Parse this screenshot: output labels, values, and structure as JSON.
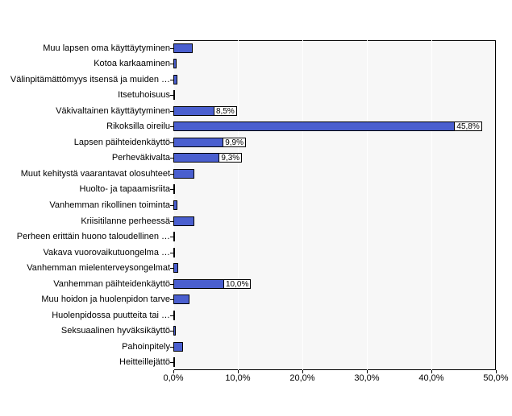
{
  "chart_data": {
    "type": "bar",
    "orientation": "horizontal",
    "categories": [
      "Muu lapsen oma käyttäytyminen",
      "Kotoa karkaaminen",
      "Välinpitämättömyys itsensä ja muiden …",
      "Itsetuhoisuus",
      "Väkivaltainen käyttäytyminen",
      "Rikoksilla oireilu",
      "Lapsen päihteidenkäyttö",
      "Perheväkivalta",
      "Muut kehitystä vaarantavat olosuhteet",
      "Huolto- ja tapaamisriita",
      "Vanhemman rikollinen toiminta",
      "Kriisitilanne perheessä",
      "Perheen erittäin huono taloudellinen …",
      "Vakava vuorovaikutuongelma …",
      "Vanhemman mielenterveysongelmat",
      "Vanhemman päihteidenkäyttö",
      "Muu hoidon ja huolenpidon tarve",
      "Huolenpidossa puutteita tai …",
      "Seksuaalinen hyväksikäyttö",
      "Pahoinpitely",
      "Heitteillejättö"
    ],
    "values": [
      3.0,
      0.5,
      0.6,
      0.3,
      8.5,
      45.8,
      9.9,
      9.3,
      3.2,
      0.3,
      0.6,
      3.2,
      0.3,
      0.2,
      0.7,
      10.0,
      2.5,
      0.3,
      0.4,
      1.5,
      0.2
    ],
    "label_visible": [
      false,
      false,
      false,
      false,
      true,
      true,
      true,
      true,
      false,
      false,
      false,
      false,
      false,
      false,
      false,
      true,
      false,
      false,
      false,
      false,
      false
    ],
    "xlim": [
      0,
      50
    ],
    "xticks": [
      0,
      10,
      20,
      30,
      40,
      50
    ],
    "xtick_labels": [
      "0,0%",
      "10,0%",
      "20,0%",
      "30,0%",
      "40,0%",
      "50,0%"
    ],
    "bar_color": "#4A5FCF"
  }
}
